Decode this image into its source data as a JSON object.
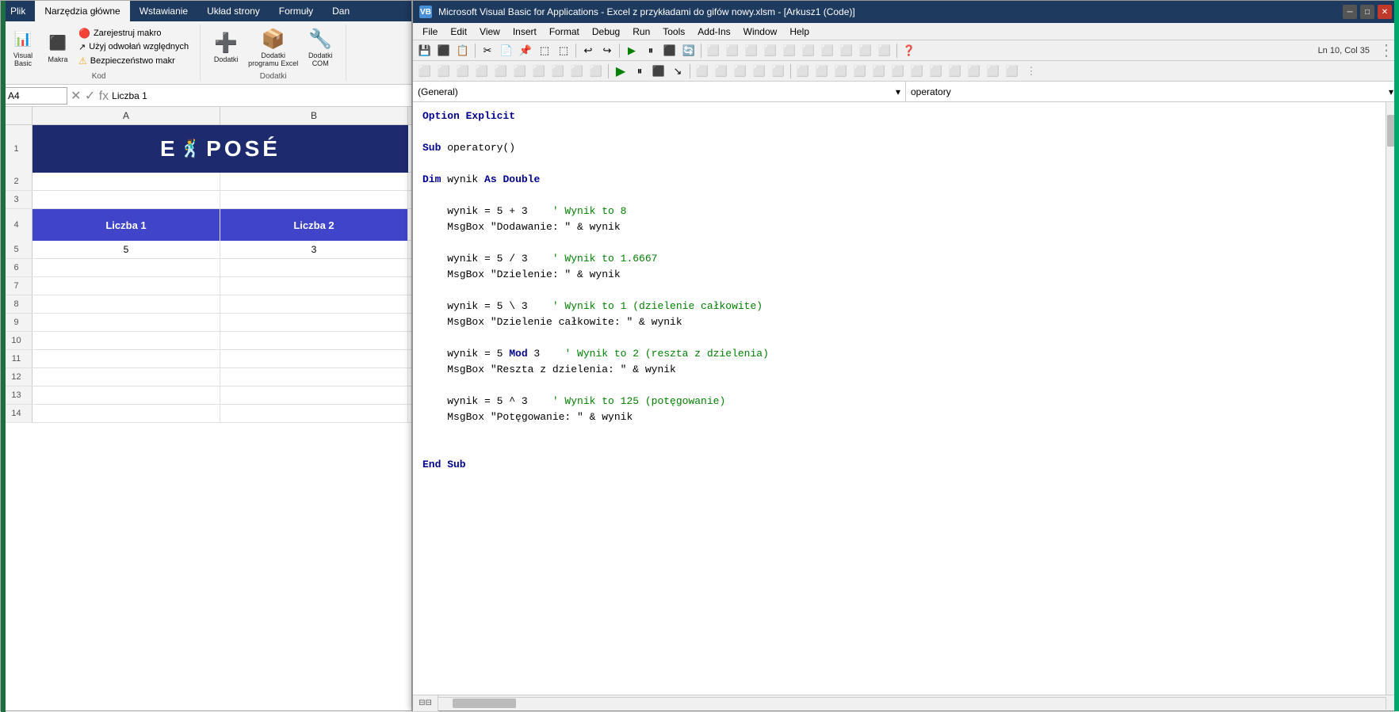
{
  "excel": {
    "title": "Excel z przykładami do gifów nowy.xlsm",
    "tabs": [
      "Plik",
      "Narzędzia główne",
      "Wstawianie",
      "Układ strony",
      "Formuły",
      "Dan"
    ],
    "active_tab": "Narzędzia główne",
    "ribbon": {
      "groups": [
        {
          "name": "Kod",
          "items": [
            {
              "label": "Visual Basic",
              "icon": "📊"
            },
            {
              "label": "Makra",
              "icon": "⬛"
            }
          ],
          "small_items": [
            {
              "label": "Zarejestruj makro",
              "icon": "🔴"
            },
            {
              "label": "Użyj odwołań względnych",
              "icon": "↗"
            },
            {
              "label": "Bezpieczeństwo makr",
              "icon": "⚠"
            }
          ]
        },
        {
          "name": "Dodatki",
          "items": [
            {
              "label": "Dodatki",
              "icon": "➕"
            },
            {
              "label": "Dodatki programu Excel",
              "icon": "📦"
            },
            {
              "label": "Dodatki COM",
              "icon": "🔧"
            }
          ]
        }
      ]
    },
    "formula_bar": {
      "cell_ref": "A4",
      "formula": "Liczba 1"
    },
    "columns": [
      "A",
      "B"
    ],
    "col_a_width": 237,
    "col_b_width": 237,
    "rows": [
      {
        "num": 1,
        "a": "LOGO",
        "b": ""
      },
      {
        "num": 2,
        "a": "",
        "b": ""
      },
      {
        "num": 3,
        "a": "",
        "b": ""
      },
      {
        "num": 4,
        "a": "Liczba 1",
        "b": "Liczba 2"
      },
      {
        "num": 5,
        "a": "5",
        "b": "3"
      },
      {
        "num": 6,
        "a": "",
        "b": ""
      },
      {
        "num": 7,
        "a": "",
        "b": ""
      },
      {
        "num": 8,
        "a": "",
        "b": ""
      },
      {
        "num": 9,
        "a": "",
        "b": ""
      },
      {
        "num": 10,
        "a": "",
        "b": ""
      },
      {
        "num": 11,
        "a": "",
        "b": ""
      },
      {
        "num": 12,
        "a": "",
        "b": ""
      },
      {
        "num": 13,
        "a": "",
        "b": ""
      },
      {
        "num": 14,
        "a": "",
        "b": ""
      }
    ],
    "logo_text": "EXPOSE"
  },
  "vba": {
    "title": "Microsoft Visual Basic for Applications - Excel z przykładami do gifów nowy.xlsm - [Arkusz1 (Code)]",
    "status": "Ln 10, Col 35",
    "menu_items": [
      "File",
      "Edit",
      "View",
      "Insert",
      "Format",
      "Debug",
      "Run",
      "Tools",
      "Add-Ins",
      "Window",
      "Help"
    ],
    "dropdown_left": "(General)",
    "dropdown_right": "operatory",
    "code": [
      {
        "type": "option",
        "text": "Option Explicit"
      },
      {
        "type": "blank"
      },
      {
        "type": "sub",
        "text": "Sub operatory()"
      },
      {
        "type": "blank"
      },
      {
        "type": "dim",
        "text": "Dim wynik As Double"
      },
      {
        "type": "blank"
      },
      {
        "type": "code",
        "text": "wynik = 5 + 3",
        "comment": "' Wynik to 8"
      },
      {
        "type": "code2",
        "text": "MsgBox \"Dodawanie: \" & wynik"
      },
      {
        "type": "blank"
      },
      {
        "type": "code",
        "text": "wynik = 5 / 3",
        "comment": "' Wynik to 1.6667"
      },
      {
        "type": "code2",
        "text": "MsgBox \"Dzielenie: \" & wynik"
      },
      {
        "type": "blank"
      },
      {
        "type": "code",
        "text": "wynik = 5 \\ 3",
        "comment": "' Wynik to 1 (dzielenie całkowite)"
      },
      {
        "type": "code2",
        "text": "MsgBox \"Dzielenie całkowite: \" & wynik"
      },
      {
        "type": "blank"
      },
      {
        "type": "code",
        "text": "wynik = 5 Mod 3",
        "comment": "' Wynik to 2 (reszta z dzielenia)"
      },
      {
        "type": "code2",
        "text": "MsgBox \"Reszta z dzielenia: \" & wynik"
      },
      {
        "type": "blank"
      },
      {
        "type": "code",
        "text": "wynik = 5 ^ 3",
        "comment": "' Wynik to 125 (potęgowanie)"
      },
      {
        "type": "code2",
        "text": "MsgBox \"Potęgowanie: \" & wynik"
      },
      {
        "type": "blank"
      },
      {
        "type": "blank"
      },
      {
        "type": "endsub",
        "text": "End Sub"
      }
    ]
  }
}
